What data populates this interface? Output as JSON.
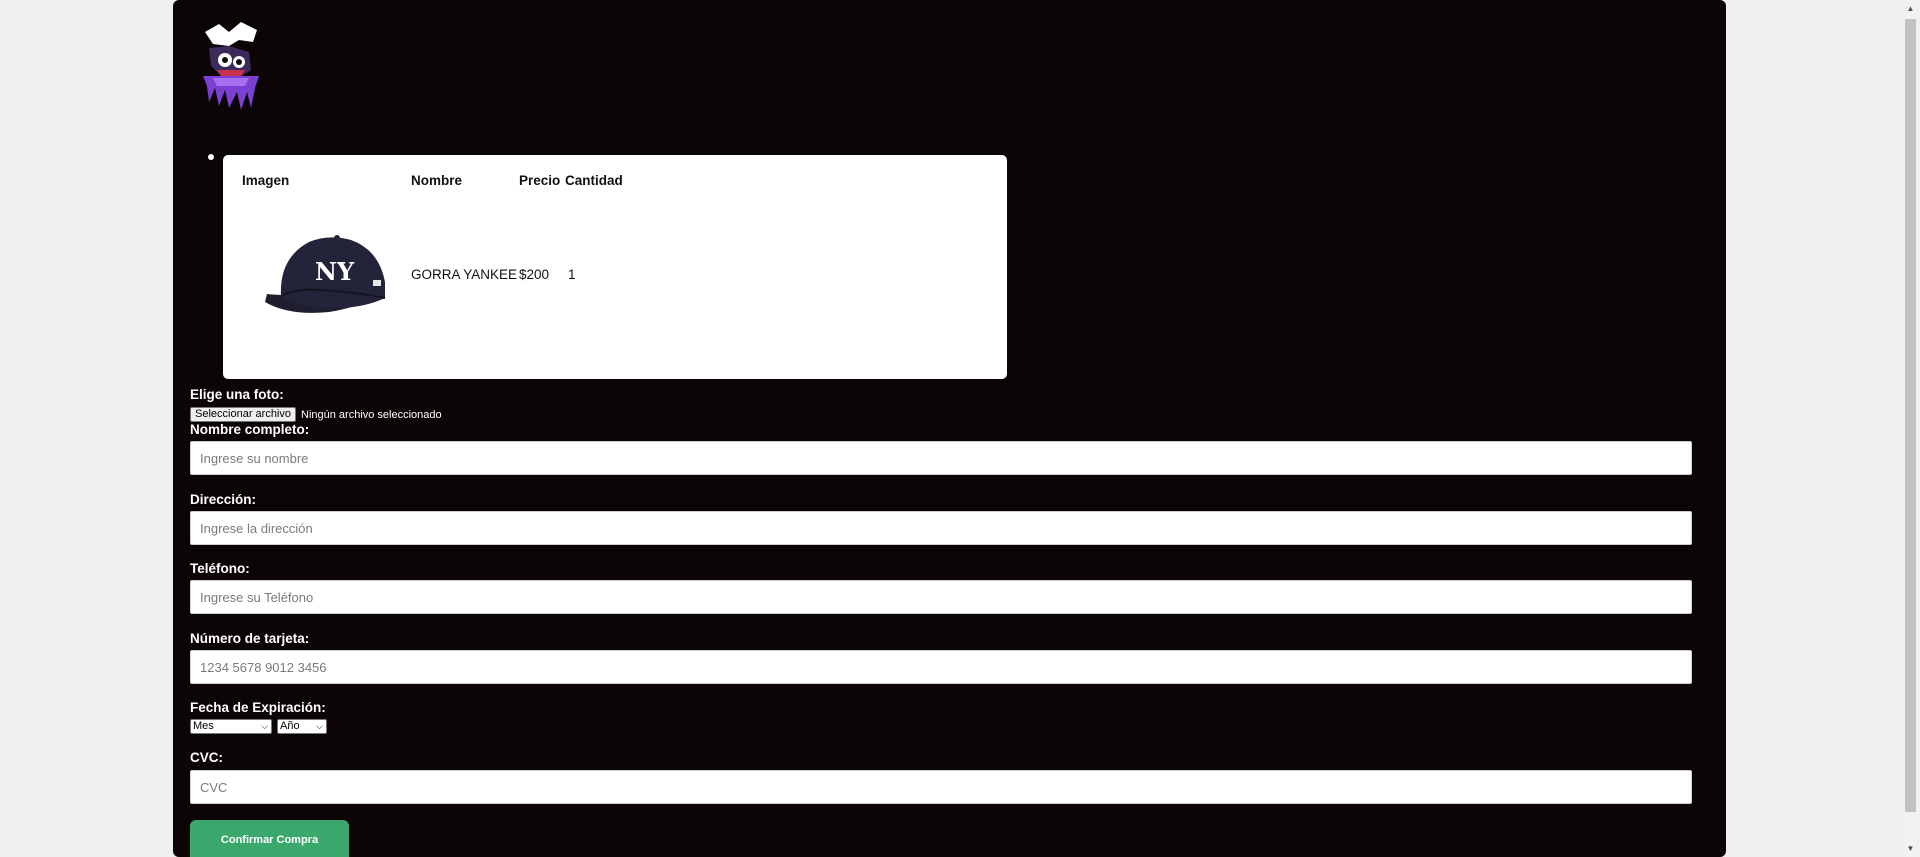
{
  "cart": {
    "headers": {
      "image": "Imagen",
      "name": "Nombre",
      "price": "Precio",
      "quantity": "Cantidad"
    },
    "items": [
      {
        "name": "GORRA YANKEE",
        "price": "$200",
        "quantity": "1",
        "image_icon": "new-york-yankees-cap"
      }
    ]
  },
  "form": {
    "photo_label": "Elige una foto:",
    "file_button": "Seleccionar archivo",
    "file_status": "Ningún archivo seleccionado",
    "name_label": "Nombre completo:",
    "name_placeholder": "Ingrese su nombre",
    "address_label": "Dirección:",
    "address_placeholder": "Ingrese la dirección",
    "phone_label": "Teléfono:",
    "phone_placeholder": "Ingrese su Teléfono",
    "card_label": "Número de tarjeta:",
    "card_placeholder": "1234 5678 9012 3456",
    "expiry_label": "Fecha de Expiración:",
    "month_value": "Mes",
    "year_value": "Año",
    "cvc_label": "CVC:",
    "cvc_placeholder": "CVC",
    "submit_label": "Confirmar Compra"
  },
  "colors": {
    "page_background": "#f0f0f0",
    "panel_background": "#0c0506",
    "confirm_button": "#3aa76d",
    "logo_accent": "#7b3fd4"
  },
  "icons": {
    "logo": "brand-logo-graffiti-character",
    "scroll_up": "triangle-up-icon",
    "scroll_down": "triangle-down-icon"
  }
}
